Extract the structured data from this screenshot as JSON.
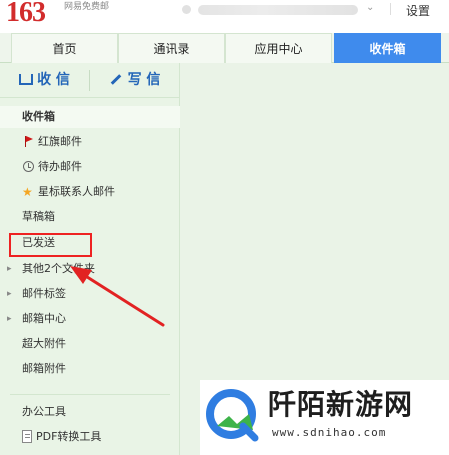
{
  "header": {
    "logo_text": "163",
    "logo_sub": "网易免费邮",
    "settings_label": "设置"
  },
  "tabs": [
    {
      "label": "首页"
    },
    {
      "label": "通讯录"
    },
    {
      "label": "应用中心"
    },
    {
      "label": "收件箱",
      "active": true
    }
  ],
  "actions": {
    "receive_label": "收 信",
    "compose_label": "写 信"
  },
  "sidebar": {
    "items": [
      {
        "label": "收件箱"
      },
      {
        "label": "红旗邮件",
        "icon": "flag-icon"
      },
      {
        "label": "待办邮件",
        "icon": "clock-icon"
      },
      {
        "label": "星标联系人邮件",
        "icon": "star-icon"
      },
      {
        "label": "草稿箱"
      },
      {
        "label": "已发送"
      },
      {
        "label": "其他2个文件夹",
        "expandable": true
      },
      {
        "label": "邮件标签",
        "expandable": true
      },
      {
        "label": "邮箱中心",
        "expandable": true
      },
      {
        "label": "超大附件"
      },
      {
        "label": "邮箱附件"
      },
      {
        "label": "办公工具"
      },
      {
        "label": "PDF转换工具",
        "icon": "pdf-icon"
      }
    ]
  },
  "watermark": {
    "title": "阡陌新游网",
    "url": "www.sdnihao.com"
  },
  "colors": {
    "brand_red": "#d22c2c",
    "active_tab_blue": "#3f8bed",
    "sidebar_green": "#e9f4e6",
    "annotation_red": "#e22222"
  }
}
